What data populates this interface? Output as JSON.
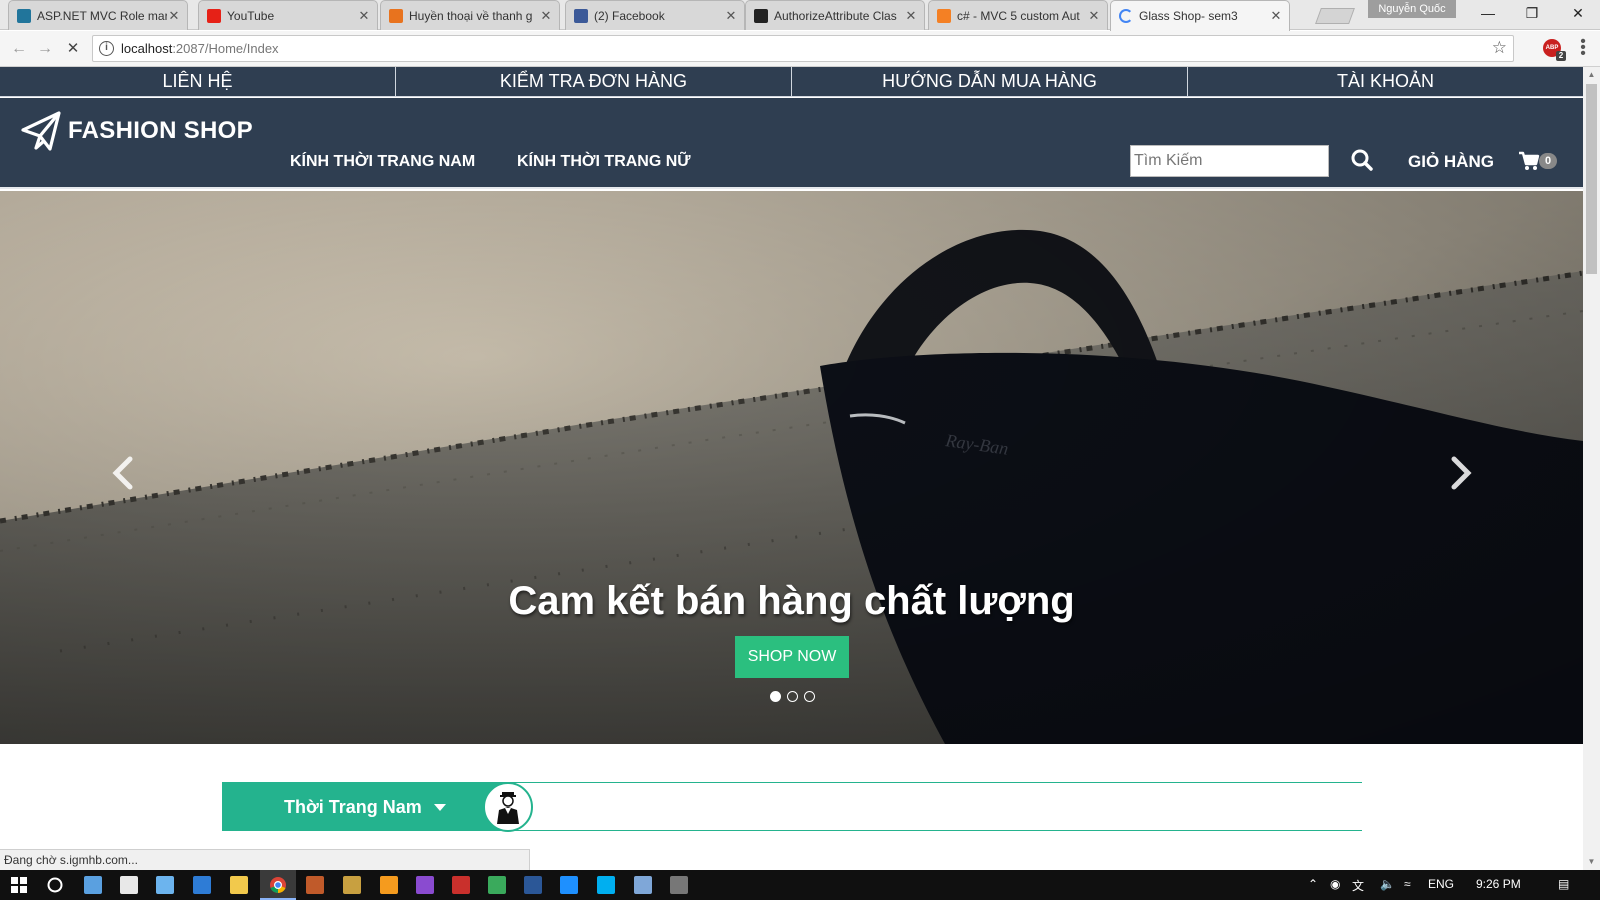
{
  "browser": {
    "tabs": [
      {
        "title": "ASP.NET MVC Role mar",
        "favicon": "wordpress-icon",
        "color": "#21759b",
        "active": false
      },
      {
        "title": "YouTube",
        "favicon": "youtube-icon",
        "color": "#e62117",
        "active": false
      },
      {
        "title": "Huyền thoại về thanh g",
        "favicon": "news-icon",
        "color": "#e8731e",
        "active": false
      },
      {
        "title": "(2) Facebook",
        "favicon": "facebook-icon",
        "color": "#3b5998",
        "active": false
      },
      {
        "title": "AuthorizeAttribute Clas",
        "favicon": "microsoft-docs-icon",
        "color": "#222222",
        "active": false
      },
      {
        "title": "c# - MVC 5 custom Aut",
        "favicon": "stackoverflow-icon",
        "color": "#f48024",
        "active": false
      },
      {
        "title": "Glass Shop- sem3",
        "favicon": "loading-spinner-icon",
        "color": "#4285f4",
        "active": true
      }
    ],
    "profile_name": "Nguyễn Quốc",
    "url_host": "localhost",
    "url_path": ":2087/Home/Index",
    "extension_badge": "2"
  },
  "site": {
    "top_menu": [
      "LIÊN HỆ",
      "KIỂM TRA ĐƠN HÀNG",
      "HƯỚNG DẪN MUA HÀNG",
      "TÀI KHOẢN"
    ],
    "brand": "FASHION SHOP",
    "nav_links": [
      "KÍNH THỜI TRANG NAM",
      "KÍNH THỜI TRANG NỮ"
    ],
    "search_placeholder": "Tìm Kiếm",
    "cart_label": "GIỎ HÀNG",
    "cart_count": "0",
    "hero": {
      "caption": "Cam kết bán hàng chất lượng",
      "button_label": "SHOP NOW",
      "slide_count": 3,
      "active_slide": 1
    },
    "category_tab": "Thời Trang Nam",
    "accent_color": "#24b38e",
    "nav_bg_color": "#2f3e51"
  },
  "status_text": "Đang chờ s.igmhb.com...",
  "taskbar": {
    "language": "ENG",
    "time": "9:26 PM"
  }
}
